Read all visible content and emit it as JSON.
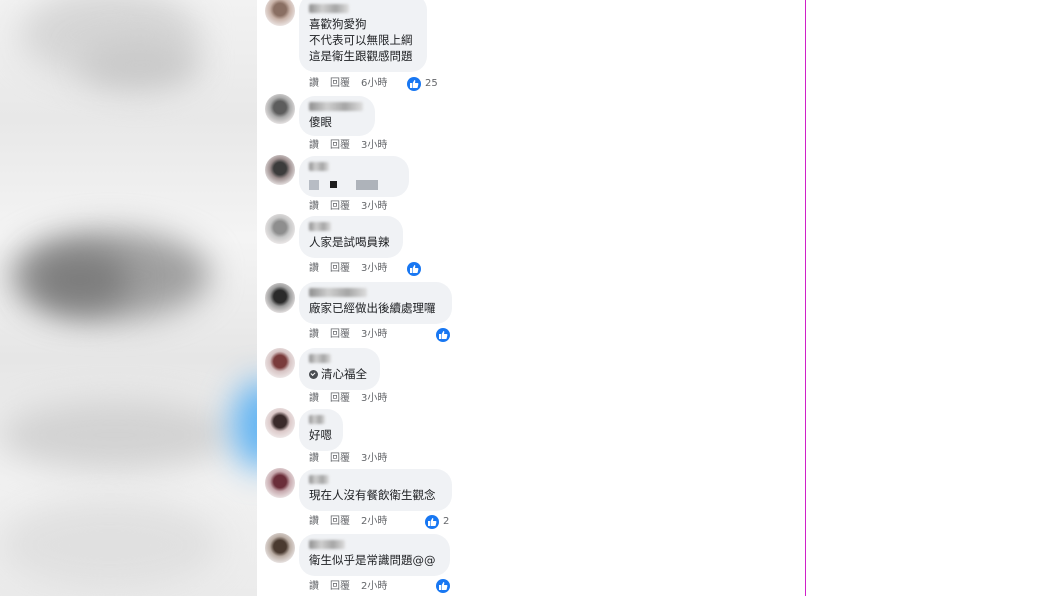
{
  "actions": {
    "like": "讚",
    "reply": "回覆"
  },
  "comments": [
    {
      "lines": [
        "喜歡狗愛狗",
        "不代表可以無限上綱",
        "這是衛生跟觀感問題"
      ],
      "time": "6小時",
      "likes": "25"
    },
    {
      "lines": [
        "傻眼"
      ],
      "time": "3小時",
      "likes": ""
    },
    {
      "lines": [],
      "time": "3小時",
      "likes": ""
    },
    {
      "lines": [
        "人家是試喝員辣"
      ],
      "time": "3小時",
      "likes": ""
    },
    {
      "lines": [
        "廠家已經做出後續處理囉"
      ],
      "time": "3小時",
      "likes": ""
    },
    {
      "lines": [
        "清心福全"
      ],
      "time": "3小時",
      "likes": ""
    },
    {
      "lines": [
        "好嗯"
      ],
      "time": "3小時",
      "likes": ""
    },
    {
      "lines": [
        "現在人沒有餐飲衛生觀念"
      ],
      "time": "2小時",
      "likes": "2"
    },
    {
      "lines": [
        "衛生似乎是常識問題@@"
      ],
      "time": "2小時",
      "likes": ""
    }
  ],
  "colors": {
    "like_blue": "#1877f2",
    "bubble_bg": "#f0f2f5",
    "meta_gray": "#65676b",
    "divider_magenta": "#d020c8"
  },
  "icons": {
    "like": "thumbs-up-icon",
    "tag": "verified-check-icon"
  }
}
